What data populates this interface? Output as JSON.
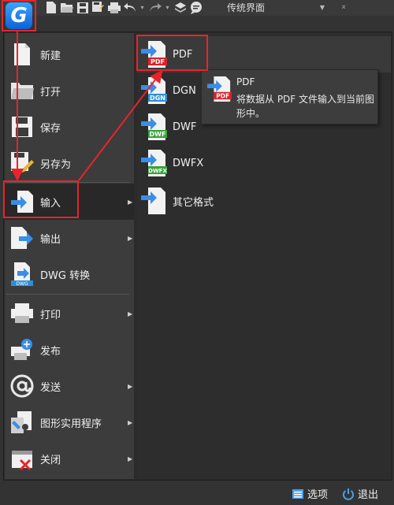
{
  "toolbar": {
    "workspace_label": "传统界面",
    "icons": [
      "new-icon",
      "open-icon",
      "save-icon",
      "save-as-icon",
      "print-icon",
      "undo-icon",
      "redo-icon",
      "layers-icon",
      "chat-icon"
    ]
  },
  "menu": {
    "items": [
      {
        "label": "新建",
        "icon": "new-file-icon",
        "has_submenu": false
      },
      {
        "label": "打开",
        "icon": "open-folder-icon",
        "has_submenu": false
      },
      {
        "label": "保存",
        "icon": "save-icon",
        "has_submenu": false
      },
      {
        "label": "另存为",
        "icon": "save-as-icon",
        "has_submenu": false
      },
      {
        "label": "输入",
        "icon": "import-icon",
        "has_submenu": true
      },
      {
        "label": "输出",
        "icon": "export-icon",
        "has_submenu": true
      },
      {
        "label": "DWG 转换",
        "icon": "dwg-convert-icon",
        "has_submenu": false
      },
      {
        "label": "打印",
        "icon": "printer-icon",
        "has_submenu": true
      },
      {
        "label": "发布",
        "icon": "publish-icon",
        "has_submenu": false
      },
      {
        "label": "发送",
        "icon": "email-at-icon",
        "has_submenu": true
      },
      {
        "label": "图形实用程序",
        "icon": "drawing-utilities-icon",
        "has_submenu": true
      },
      {
        "label": "关闭",
        "icon": "close-drawing-icon",
        "has_submenu": true
      }
    ]
  },
  "submenu": {
    "items": [
      {
        "label": "PDF",
        "badge": "PDF",
        "badge_color": "#d9232a"
      },
      {
        "label": "DGN",
        "badge": "DGN",
        "badge_color": "#2e8fd8"
      },
      {
        "label": "DWF",
        "badge": "DWF",
        "badge_color": "#3aa33a"
      },
      {
        "label": "DWFX",
        "badge": "DWFX",
        "badge_color": "#3aa33a"
      },
      {
        "label": "其它格式",
        "badge": "",
        "badge_color": "#888888"
      }
    ]
  },
  "tooltip": {
    "title": "PDF",
    "badge": "PDF",
    "description": "将数据从 PDF 文件输入到当前图形中。"
  },
  "bottom": {
    "options_label": "选项",
    "exit_label": "退出"
  },
  "colors": {
    "highlight": "#e8242a",
    "accent_blue": "#3a8ee6",
    "background": "#333333"
  }
}
